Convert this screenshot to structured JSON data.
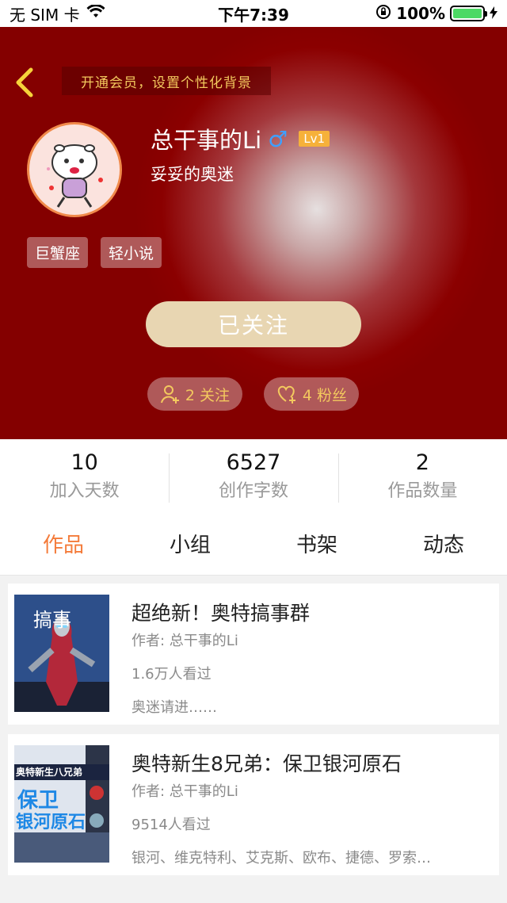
{
  "status_bar": {
    "carrier": "无 SIM 卡",
    "time": "下午7:39",
    "battery": "100%"
  },
  "header": {
    "vip_banner": "开通会员，设置个性化背景",
    "nickname": "总干事的Li",
    "gender_symbol": "♂",
    "level": "Lv1",
    "signature": "妥妥的奥迷",
    "tags": [
      "巨蟹座",
      "轻小说"
    ],
    "follow_button": "已关注",
    "following": "2 关注",
    "fans": "4 粉丝"
  },
  "stats": [
    {
      "value": "10",
      "label": "加入天数"
    },
    {
      "value": "6527",
      "label": "创作字数"
    },
    {
      "value": "2",
      "label": "作品数量"
    }
  ],
  "tabs": [
    "作品",
    "小组",
    "书架",
    "动态"
  ],
  "works": [
    {
      "title": "超绝新！奥特搞事群",
      "author": "作者: 总干事的Li",
      "views": "1.6万人看过",
      "desc": "奥迷请进……",
      "cover_text": "搞事"
    },
    {
      "title": "奥特新生8兄弟：保卫银河原石",
      "author": "作者: 总干事的Li",
      "views": "9514人看过",
      "desc": "银河、维克特利、艾克斯、欧布、捷德、罗索…",
      "cover_text": "奥特新生八兄弟",
      "cover_text2": "保卫",
      "cover_text3": "银河原石"
    }
  ],
  "colors": {
    "accent": "#f47b3a",
    "header_red": "#8b0000",
    "follow_bg": "#e8d6b2",
    "vip_text": "#f3c95e"
  }
}
